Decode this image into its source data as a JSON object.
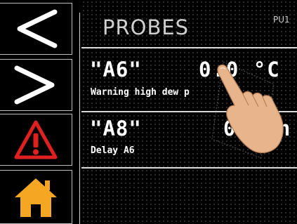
{
  "header": {
    "title": "PROBES",
    "unit_code": "PU1"
  },
  "sidebar": {
    "items": [
      {
        "icon": "chevron-left-icon",
        "label": "Previous"
      },
      {
        "icon": "chevron-right-icon",
        "label": "Next"
      },
      {
        "icon": "alarm-warning-icon",
        "label": "Alarms"
      },
      {
        "icon": "home-icon",
        "label": "Home"
      }
    ]
  },
  "probes": [
    {
      "name": "\"A6\"",
      "value": "0.0 °C",
      "status": "Warning high dew p"
    },
    {
      "name": "\"A8\"",
      "value": "0 min",
      "status": "Delay A6"
    }
  ],
  "colors": {
    "warning_red": "#e02020",
    "home_orange": "#f5a623",
    "text": "#ffffff",
    "background": "#000000"
  },
  "overlay": {
    "icon": "touch-hand-icon"
  }
}
